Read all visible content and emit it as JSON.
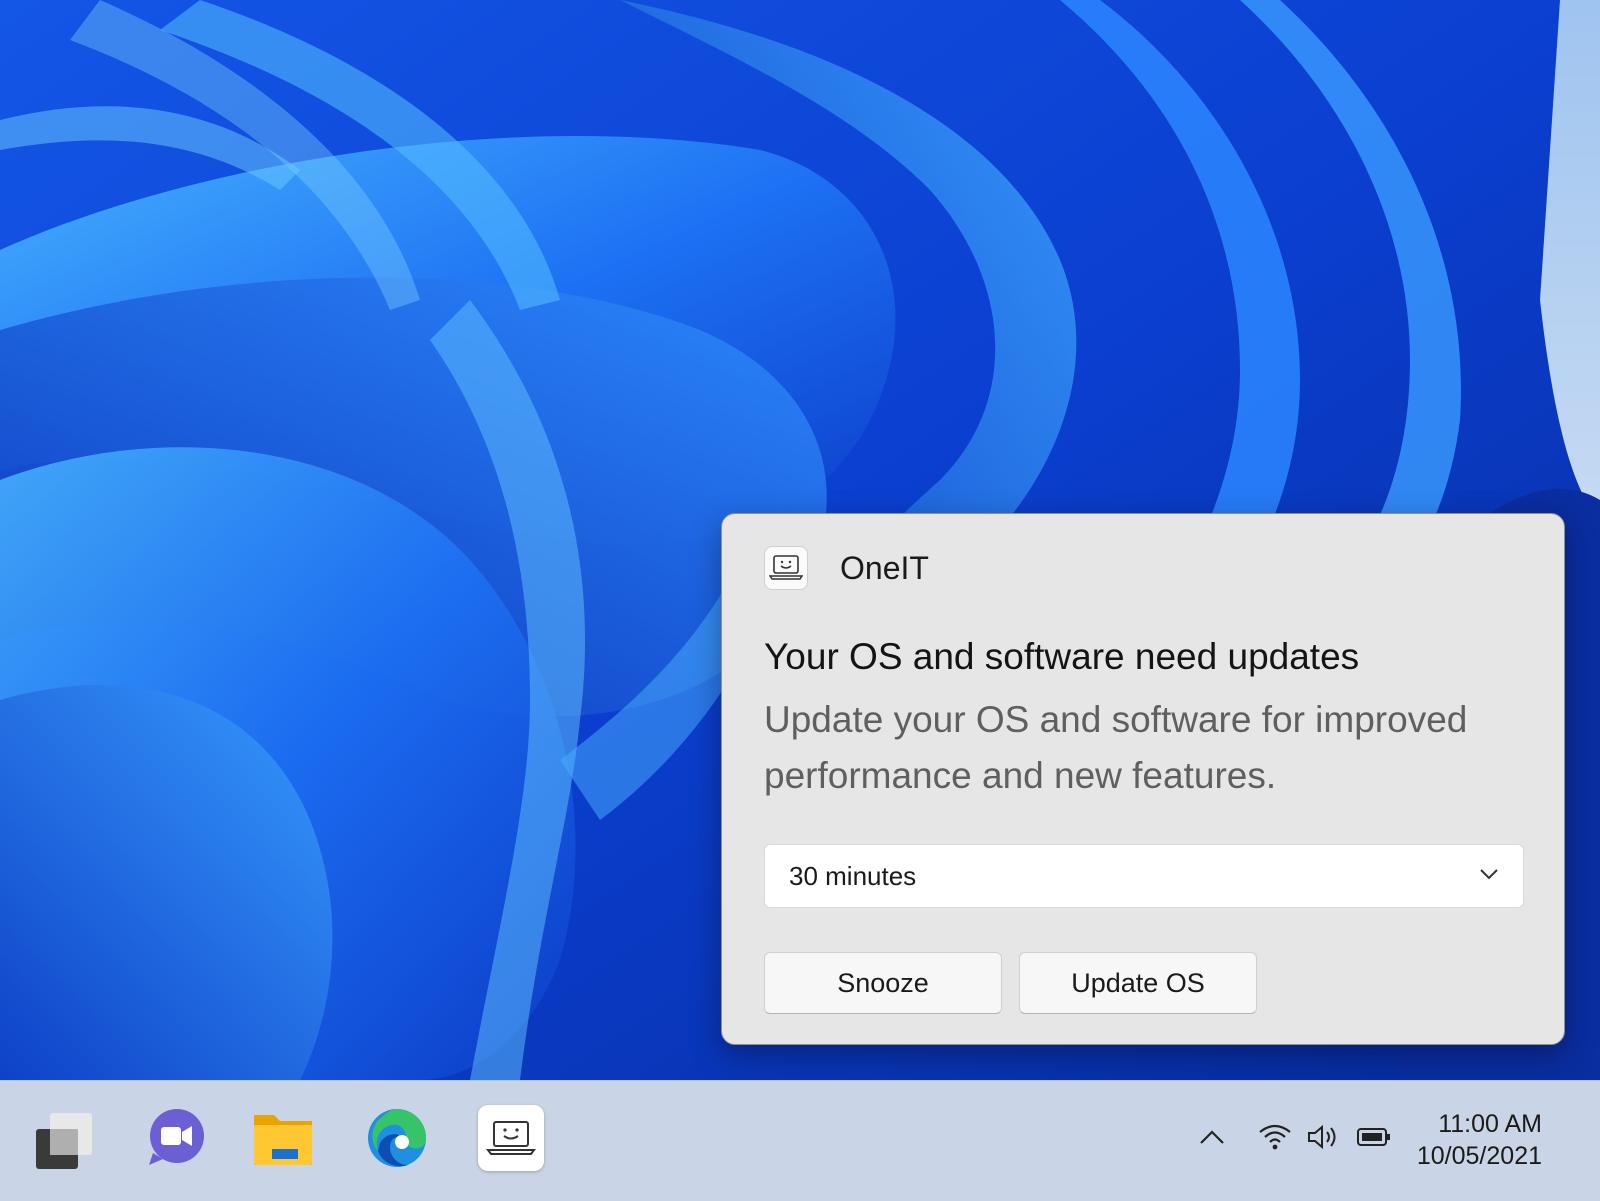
{
  "toast": {
    "app_name": "OneIT",
    "app_icon": "laptop-smile-icon",
    "title": "Your OS and software need updates",
    "body": "Update your OS and software for improved performance and new features.",
    "dropdown": {
      "selected": "30 minutes",
      "icon": "chevron-down-icon"
    },
    "buttons": {
      "snooze": "Snooze",
      "update": "Update OS"
    }
  },
  "taskbar": {
    "apps": [
      "start-icon",
      "teams-icon",
      "file-explorer-icon",
      "edge-icon",
      "oneit-icon"
    ],
    "tray": [
      "chevron-up-icon",
      "wifi-icon",
      "volume-icon",
      "battery-icon"
    ],
    "clock": {
      "time": "11:00 AM",
      "date": "10/05/2021"
    }
  },
  "colors": {
    "wallpaper_dark": "#0a2fa0",
    "wallpaper_mid": "#1763f0",
    "wallpaper_light": "#3fa7ff",
    "toast_bg": "#e6e6e6",
    "taskbar_bg": "#c9d5e6"
  }
}
